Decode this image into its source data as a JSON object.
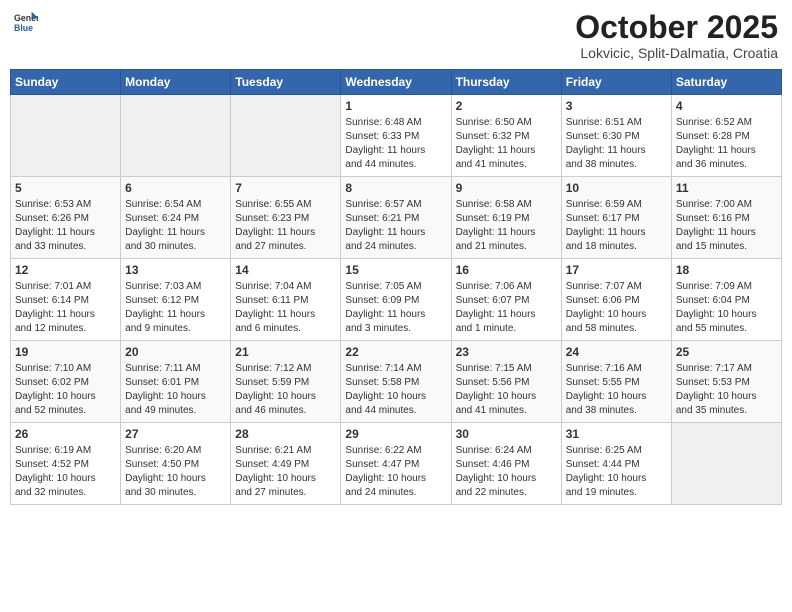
{
  "header": {
    "logo_general": "General",
    "logo_blue": "Blue",
    "month_title": "October 2025",
    "location": "Lokvicic, Split-Dalmatia, Croatia"
  },
  "weekdays": [
    "Sunday",
    "Monday",
    "Tuesday",
    "Wednesday",
    "Thursday",
    "Friday",
    "Saturday"
  ],
  "weeks": [
    [
      {
        "day": "",
        "info": ""
      },
      {
        "day": "",
        "info": ""
      },
      {
        "day": "",
        "info": ""
      },
      {
        "day": "1",
        "info": "Sunrise: 6:48 AM\nSunset: 6:33 PM\nDaylight: 11 hours\nand 44 minutes."
      },
      {
        "day": "2",
        "info": "Sunrise: 6:50 AM\nSunset: 6:32 PM\nDaylight: 11 hours\nand 41 minutes."
      },
      {
        "day": "3",
        "info": "Sunrise: 6:51 AM\nSunset: 6:30 PM\nDaylight: 11 hours\nand 38 minutes."
      },
      {
        "day": "4",
        "info": "Sunrise: 6:52 AM\nSunset: 6:28 PM\nDaylight: 11 hours\nand 36 minutes."
      }
    ],
    [
      {
        "day": "5",
        "info": "Sunrise: 6:53 AM\nSunset: 6:26 PM\nDaylight: 11 hours\nand 33 minutes."
      },
      {
        "day": "6",
        "info": "Sunrise: 6:54 AM\nSunset: 6:24 PM\nDaylight: 11 hours\nand 30 minutes."
      },
      {
        "day": "7",
        "info": "Sunrise: 6:55 AM\nSunset: 6:23 PM\nDaylight: 11 hours\nand 27 minutes."
      },
      {
        "day": "8",
        "info": "Sunrise: 6:57 AM\nSunset: 6:21 PM\nDaylight: 11 hours\nand 24 minutes."
      },
      {
        "day": "9",
        "info": "Sunrise: 6:58 AM\nSunset: 6:19 PM\nDaylight: 11 hours\nand 21 minutes."
      },
      {
        "day": "10",
        "info": "Sunrise: 6:59 AM\nSunset: 6:17 PM\nDaylight: 11 hours\nand 18 minutes."
      },
      {
        "day": "11",
        "info": "Sunrise: 7:00 AM\nSunset: 6:16 PM\nDaylight: 11 hours\nand 15 minutes."
      }
    ],
    [
      {
        "day": "12",
        "info": "Sunrise: 7:01 AM\nSunset: 6:14 PM\nDaylight: 11 hours\nand 12 minutes."
      },
      {
        "day": "13",
        "info": "Sunrise: 7:03 AM\nSunset: 6:12 PM\nDaylight: 11 hours\nand 9 minutes."
      },
      {
        "day": "14",
        "info": "Sunrise: 7:04 AM\nSunset: 6:11 PM\nDaylight: 11 hours\nand 6 minutes."
      },
      {
        "day": "15",
        "info": "Sunrise: 7:05 AM\nSunset: 6:09 PM\nDaylight: 11 hours\nand 3 minutes."
      },
      {
        "day": "16",
        "info": "Sunrise: 7:06 AM\nSunset: 6:07 PM\nDaylight: 11 hours\nand 1 minute."
      },
      {
        "day": "17",
        "info": "Sunrise: 7:07 AM\nSunset: 6:06 PM\nDaylight: 10 hours\nand 58 minutes."
      },
      {
        "day": "18",
        "info": "Sunrise: 7:09 AM\nSunset: 6:04 PM\nDaylight: 10 hours\nand 55 minutes."
      }
    ],
    [
      {
        "day": "19",
        "info": "Sunrise: 7:10 AM\nSunset: 6:02 PM\nDaylight: 10 hours\nand 52 minutes."
      },
      {
        "day": "20",
        "info": "Sunrise: 7:11 AM\nSunset: 6:01 PM\nDaylight: 10 hours\nand 49 minutes."
      },
      {
        "day": "21",
        "info": "Sunrise: 7:12 AM\nSunset: 5:59 PM\nDaylight: 10 hours\nand 46 minutes."
      },
      {
        "day": "22",
        "info": "Sunrise: 7:14 AM\nSunset: 5:58 PM\nDaylight: 10 hours\nand 44 minutes."
      },
      {
        "day": "23",
        "info": "Sunrise: 7:15 AM\nSunset: 5:56 PM\nDaylight: 10 hours\nand 41 minutes."
      },
      {
        "day": "24",
        "info": "Sunrise: 7:16 AM\nSunset: 5:55 PM\nDaylight: 10 hours\nand 38 minutes."
      },
      {
        "day": "25",
        "info": "Sunrise: 7:17 AM\nSunset: 5:53 PM\nDaylight: 10 hours\nand 35 minutes."
      }
    ],
    [
      {
        "day": "26",
        "info": "Sunrise: 6:19 AM\nSunset: 4:52 PM\nDaylight: 10 hours\nand 32 minutes."
      },
      {
        "day": "27",
        "info": "Sunrise: 6:20 AM\nSunset: 4:50 PM\nDaylight: 10 hours\nand 30 minutes."
      },
      {
        "day": "28",
        "info": "Sunrise: 6:21 AM\nSunset: 4:49 PM\nDaylight: 10 hours\nand 27 minutes."
      },
      {
        "day": "29",
        "info": "Sunrise: 6:22 AM\nSunset: 4:47 PM\nDaylight: 10 hours\nand 24 minutes."
      },
      {
        "day": "30",
        "info": "Sunrise: 6:24 AM\nSunset: 4:46 PM\nDaylight: 10 hours\nand 22 minutes."
      },
      {
        "day": "31",
        "info": "Sunrise: 6:25 AM\nSunset: 4:44 PM\nDaylight: 10 hours\nand 19 minutes."
      },
      {
        "day": "",
        "info": ""
      }
    ]
  ]
}
